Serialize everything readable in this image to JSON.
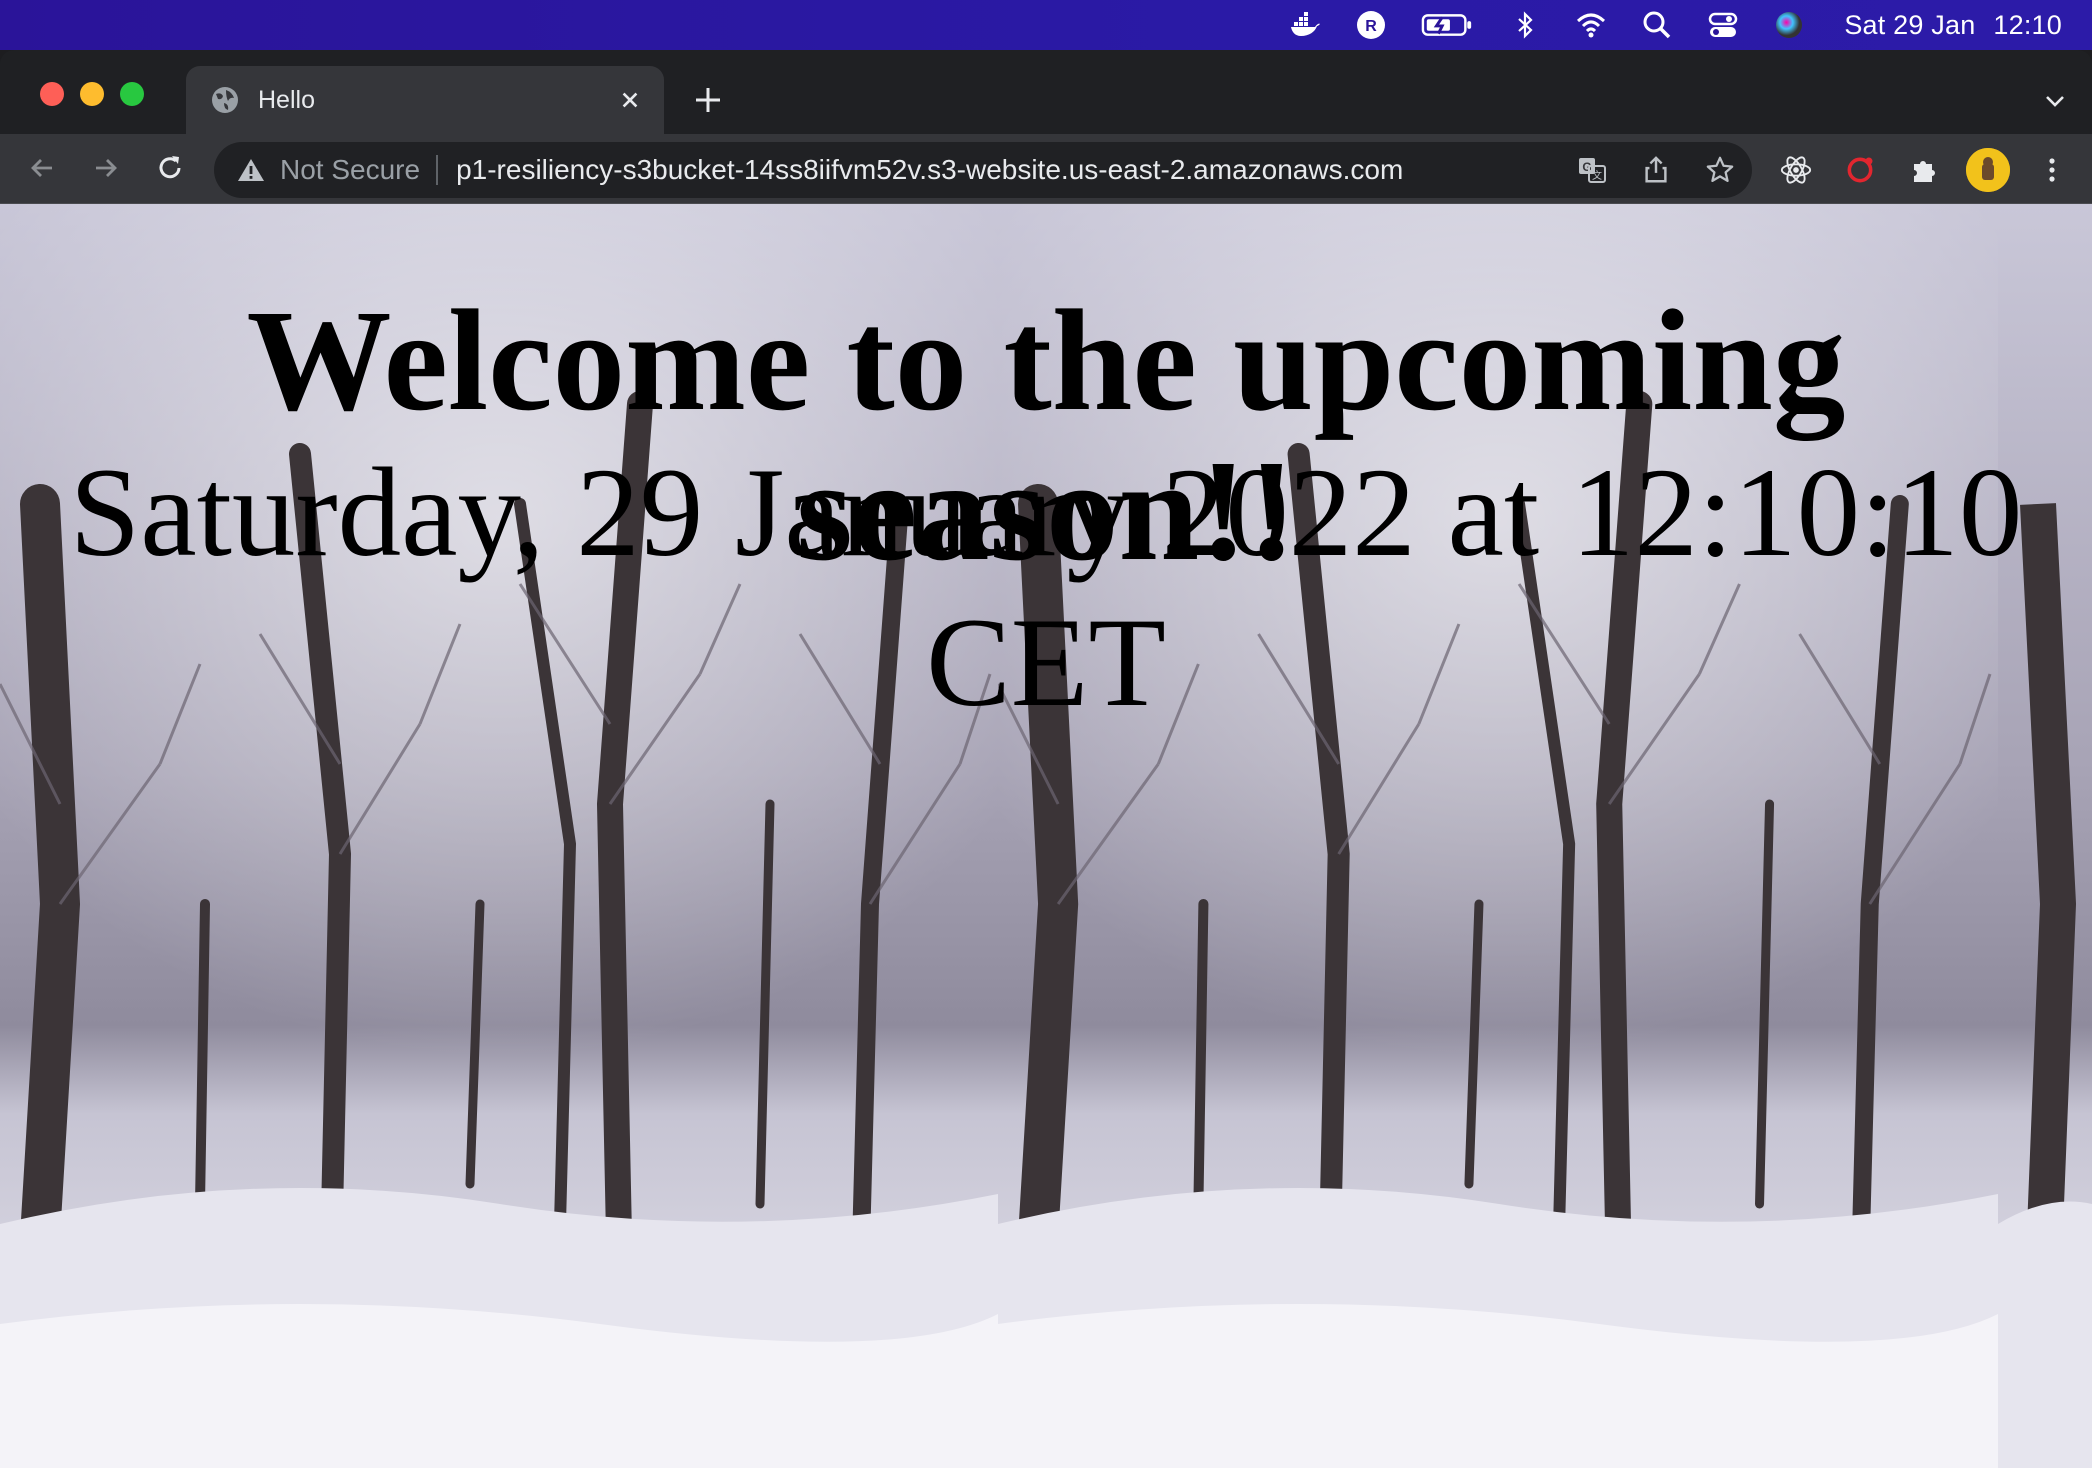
{
  "menubar": {
    "icons": [
      "docker-icon",
      "r-app-icon",
      "battery-charging-icon",
      "bluetooth-icon",
      "wifi-icon",
      "spotlight-search-icon",
      "control-center-icon",
      "siri-icon"
    ],
    "date": "Sat 29 Jan",
    "time": "12:10"
  },
  "browser": {
    "tab_title": "Hello",
    "security_label": "Not Secure",
    "url": "p1-resiliency-s3bucket-14ss8iifvm52v.s3-website.us-east-2.amazonaws.com"
  },
  "page": {
    "heading": "Welcome to the upcoming season!!",
    "datetime": "Saturday, 29 January 2022 at 12:10:10 CET"
  },
  "colors": {
    "menubar_bg": "#2a1499",
    "browser_frame": "#1f2023",
    "toolbar": "#35363a",
    "omnibox": "#202124",
    "page_text": "#000000"
  }
}
